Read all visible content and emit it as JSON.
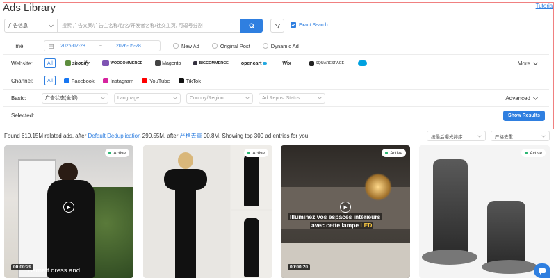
{
  "header": {
    "title": "Ads Library",
    "tutorial": "Tutorial"
  },
  "search": {
    "type_label": "广告信息",
    "placeholder": "搜索 广告文案/广告主名称/包名/开发者名称/社交主页, 可逗号分割",
    "exact_label": "Exact Search"
  },
  "time": {
    "label": "Time:",
    "start": "2026-02-28",
    "separator": "~",
    "end": "2026-05-28",
    "options": [
      "New Ad",
      "Original Post",
      "Dynamic Ad"
    ]
  },
  "website": {
    "label": "Website:",
    "all": "All",
    "logos": [
      {
        "name": "shopify",
        "icon": "shopify-icon",
        "color": "#5e8e3e"
      },
      {
        "name": "WOOCOMMERCE",
        "icon": "woocommerce-icon",
        "color": "#7f54b3"
      },
      {
        "name": "Magento",
        "icon": "magento-icon",
        "color": "#444444"
      },
      {
        "name": "BIGCOMMERCE",
        "icon": "bigcommerce-icon",
        "color": "#34313f"
      },
      {
        "name": "opencart",
        "icon": "opencart-icon",
        "color": "#23a8e0"
      },
      {
        "name": "Wix",
        "icon": "wix-icon",
        "color": "#000000"
      },
      {
        "name": "SQUARESPACE",
        "icon": "squarespace-icon",
        "color": "#222222"
      },
      {
        "name": "",
        "icon": "salesforce-icon",
        "color": "#00a1e0"
      }
    ],
    "more": "More"
  },
  "channel": {
    "label": "Channel:",
    "all": "All",
    "items": [
      {
        "name": "Facebook",
        "icon": "facebook-icon",
        "color": "#1877f2"
      },
      {
        "name": "Instagram",
        "icon": "instagram-icon",
        "color": "#d6249f"
      },
      {
        "name": "YouTube",
        "icon": "youtube-icon",
        "color": "#ff0000"
      },
      {
        "name": "TikTok",
        "icon": "tiktok-icon",
        "color": "#111111"
      }
    ]
  },
  "basic": {
    "label": "Basic:",
    "ad_status": "广告状态(全部)",
    "language": "Language",
    "country": "Country/Region",
    "repost": "Ad Repost Status",
    "advanced": "Advanced"
  },
  "selected": {
    "label": "Selected:",
    "show_results": "Show Results"
  },
  "results": {
    "found_prefix": "Found 610.15M related ads, after ",
    "dedup_link": "Default Deduplication",
    "dedup_count": " 290.55M,  after ",
    "strict_link": "严格去重",
    "strict_count": " 90.8M, Showing top 300 ad entries for you",
    "sort": "按最后曝光排序",
    "dedup_sel": "严格去重"
  },
  "cards": [
    {
      "status": "Active",
      "duration": "00:00:29",
      "caption": "Barnett dress and"
    },
    {
      "status": "Active"
    },
    {
      "status": "Active",
      "duration": "00:00:20",
      "caption_line1": "Illuminez vos espaces intérieurs",
      "caption_line2": "avec cette lampe",
      "caption_emoji": "LED"
    },
    {
      "status": "Active"
    }
  ],
  "colors": {
    "accent": "#2f7fe0",
    "panel_border": "#f08080",
    "active_dot": "#2bb673"
  }
}
